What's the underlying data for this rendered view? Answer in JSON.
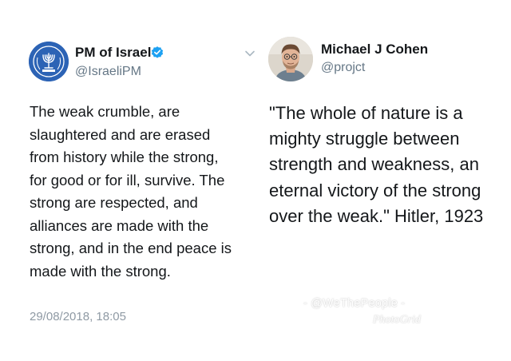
{
  "left_tweet": {
    "name": "PM of Israel",
    "handle": "@IsraeliPM",
    "text": "The weak crumble, are\nslaughtered and are erased\nfrom history while the strong,\nfor good or for ill, survive. The\nstrong are respected, and\nalliances are made with the\nstrong, and in the end peace is\nmade with the strong.",
    "timestamp": "29/08/2018, 18:05",
    "avatar_icon": "state-emblem-icon",
    "verified_icon": "verified-badge-icon",
    "menu_icon": "chevron-down-icon",
    "colors": {
      "verified": "#1da1f2",
      "avatar_bg": "#2c63b5"
    }
  },
  "right_tweet": {
    "name": "Michael J Cohen",
    "handle": "@projct",
    "text": "\"The whole of nature is a\nmighty struggle between\nstrength and weakness, an\neternal victory of the strong\nover the weak.\" Hitler, 1923",
    "avatar_icon": "profile-photo-icon"
  },
  "watermark": {
    "line1": "- @WeThePeople -",
    "line2": "PhotoGrid"
  }
}
